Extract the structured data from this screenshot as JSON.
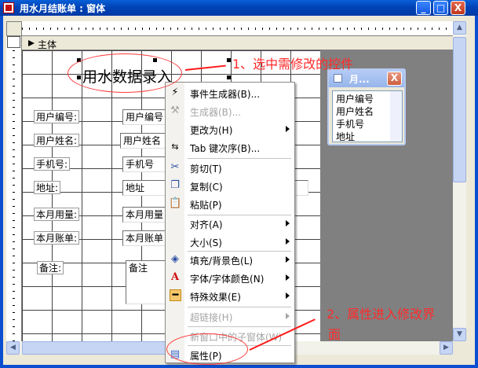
{
  "window": {
    "title": "用水月结账单 : 窗体",
    "minimize": "_",
    "maximize": "□",
    "close": "X"
  },
  "section": {
    "label": "主体"
  },
  "form": {
    "title": "用水数据录入",
    "fields": [
      {
        "label": "用户编号:",
        "value": "用户编号"
      },
      {
        "label": "用户姓名:",
        "value": "用户姓名"
      },
      {
        "label": "手机号:",
        "value": "手机号"
      },
      {
        "label": "地址:",
        "value": "地址"
      },
      {
        "label": "本月用量:",
        "value": "本月用量"
      },
      {
        "label": "本月账单:",
        "value": "本月账单"
      },
      {
        "label": "备注:",
        "value": "备注"
      }
    ]
  },
  "field_list": {
    "title": "月...",
    "items": [
      "用户编号",
      "用户姓名",
      "手机号",
      "地址"
    ]
  },
  "context_menu": {
    "items": [
      {
        "label": "事件生成器(B)...",
        "icon": "event-builder-icon",
        "enabled": true
      },
      {
        "label": "生成器(B)...",
        "icon": "builder-wand-icon",
        "enabled": false
      },
      {
        "label": "更改为(H)",
        "submenu": true,
        "enabled": true
      },
      {
        "label": "Tab 键次序(B)...",
        "icon": "tab-order-icon",
        "enabled": true
      },
      {
        "label": "剪切(T)",
        "icon": "scissors-icon",
        "enabled": true
      },
      {
        "label": "复制(C)",
        "icon": "copy-icon",
        "enabled": true
      },
      {
        "label": "粘贴(P)",
        "icon": "paste-icon",
        "enabled": true
      },
      {
        "label": "对齐(A)",
        "submenu": true,
        "enabled": true
      },
      {
        "label": "大小(S)",
        "submenu": true,
        "enabled": true
      },
      {
        "label": "填充/背景色(L)",
        "icon": "fill-color-icon",
        "submenu": true,
        "enabled": true
      },
      {
        "label": "字体/字体颜色(N)",
        "icon": "font-color-icon",
        "submenu": true,
        "enabled": true
      },
      {
        "label": "特殊效果(E)",
        "icon": "special-effect-icon",
        "submenu": true,
        "enabled": true
      },
      {
        "label": "超链接(H)",
        "submenu": true,
        "enabled": false
      },
      {
        "label": "新窗口中的子窗体(W)",
        "enabled": false
      },
      {
        "label": "属性(P)",
        "icon": "properties-icon",
        "enabled": true
      }
    ]
  },
  "annotations": {
    "step1": "1、选中需修改的控件",
    "step2_line1": "2、属性进入修改界",
    "step2_line2": "面"
  },
  "colors": {
    "titlebar": "#0a5fd8",
    "annotation": "#ff2a2a",
    "grid_line": "#444444",
    "gray_area": "#808080"
  }
}
